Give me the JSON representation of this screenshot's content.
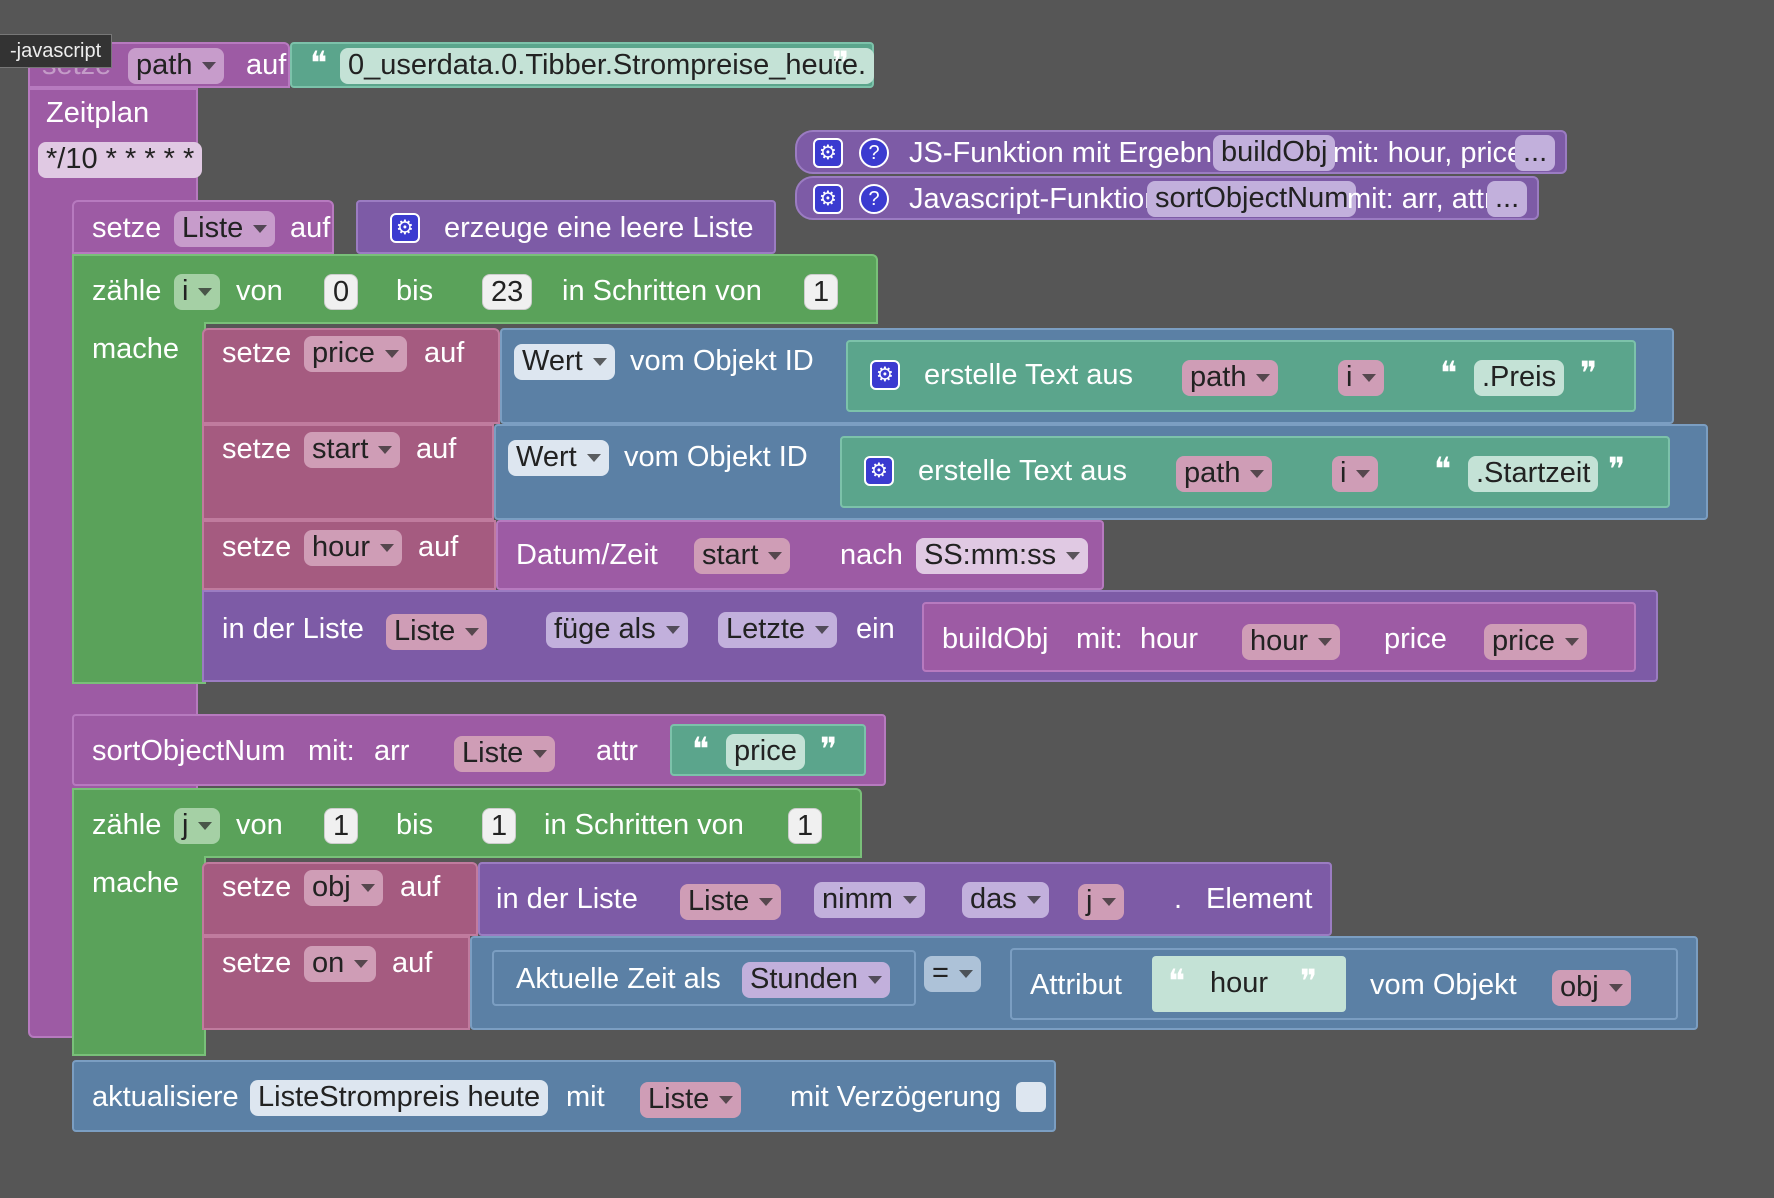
{
  "tooltip": "-javascript",
  "top_set": {
    "keyword": "setze",
    "var": "path",
    "to": "auf",
    "value": "0_userdata.0.Tibber.Strompreise_heute."
  },
  "schedule": {
    "label": "Zeitplan",
    "cron": "*/10 * * * * *"
  },
  "func1": {
    "label": "JS-Funktion mit Ergebnis",
    "name": "buildObj",
    "params": "mit: hour, price",
    "more": "..."
  },
  "func2": {
    "label": "Javascript-Funktion",
    "name": "sortObjectNum",
    "params": "mit: arr, attr",
    "more": "..."
  },
  "set_list": {
    "keyword": "setze",
    "var": "Liste",
    "to": "auf",
    "value": "erzeuge eine leere Liste"
  },
  "loop1": {
    "count": "zähle",
    "var": "i",
    "from": "von",
    "from_val": "0",
    "to": "bis",
    "to_val": "23",
    "step": "in Schritten von",
    "step_val": "1",
    "do": "mache"
  },
  "set_price": {
    "keyword": "setze",
    "var": "price",
    "to": "auf",
    "wert": "Wert",
    "of": "vom Objekt ID",
    "text": "erstelle Text aus",
    "p1": "path",
    "p2": "i",
    "p3": ".Preis"
  },
  "set_start": {
    "keyword": "setze",
    "var": "start",
    "to": "auf",
    "wert": "Wert",
    "of": "vom Objekt ID",
    "text": "erstelle Text aus",
    "p1": "path",
    "p2": "i",
    "p3": ".Startzeit"
  },
  "set_hour": {
    "keyword": "setze",
    "var": "hour",
    "to": "auf",
    "dt": "Datum/Zeit",
    "arg": "start",
    "nach": "nach",
    "fmt": "SS:mm:ss"
  },
  "list_add": {
    "label": "in der Liste",
    "list": "Liste",
    "mode": "füge als",
    "pos": "Letzte",
    "ein": "ein",
    "call": "buildObj",
    "mit": "mit:",
    "a1": "hour",
    "v1": "hour",
    "a2": "price",
    "v2": "price"
  },
  "sort_call": {
    "name": "sortObjectNum",
    "mit": "mit:",
    "a1": "arr",
    "v1": "Liste",
    "a2": "attr",
    "v2": "price"
  },
  "loop2": {
    "count": "zähle",
    "var": "j",
    "from": "von",
    "from_val": "1",
    "to": "bis",
    "to_val": "1",
    "step": "in Schritten von",
    "step_val": "1",
    "do": "mache"
  },
  "set_obj": {
    "keyword": "setze",
    "var": "obj",
    "to": "auf",
    "label": "in der Liste",
    "list": "Liste",
    "take": "nimm",
    "das": "das",
    "idx": "j",
    "dot": ".",
    "elem": "Element"
  },
  "set_on": {
    "keyword": "setze",
    "var": "on",
    "to": "auf",
    "now": "Aktuelle Zeit als",
    "unit": "Stunden",
    "op": "=",
    "attr": "Attribut",
    "attr_val": "hour",
    "of": "vom Objekt",
    "obj": "obj"
  },
  "update": {
    "label": "aktualisiere",
    "target": "ListeStrompreis heute",
    "mit": "mit",
    "val": "Liste",
    "delay": "mit Verzögerung"
  },
  "colors": {
    "purple": "#9d5ba4",
    "green": "#5aa25a",
    "blue": "#5b80a5",
    "violet": "#7d5ba6",
    "teal": "#5ba58c",
    "magenta": "#a55b80"
  }
}
